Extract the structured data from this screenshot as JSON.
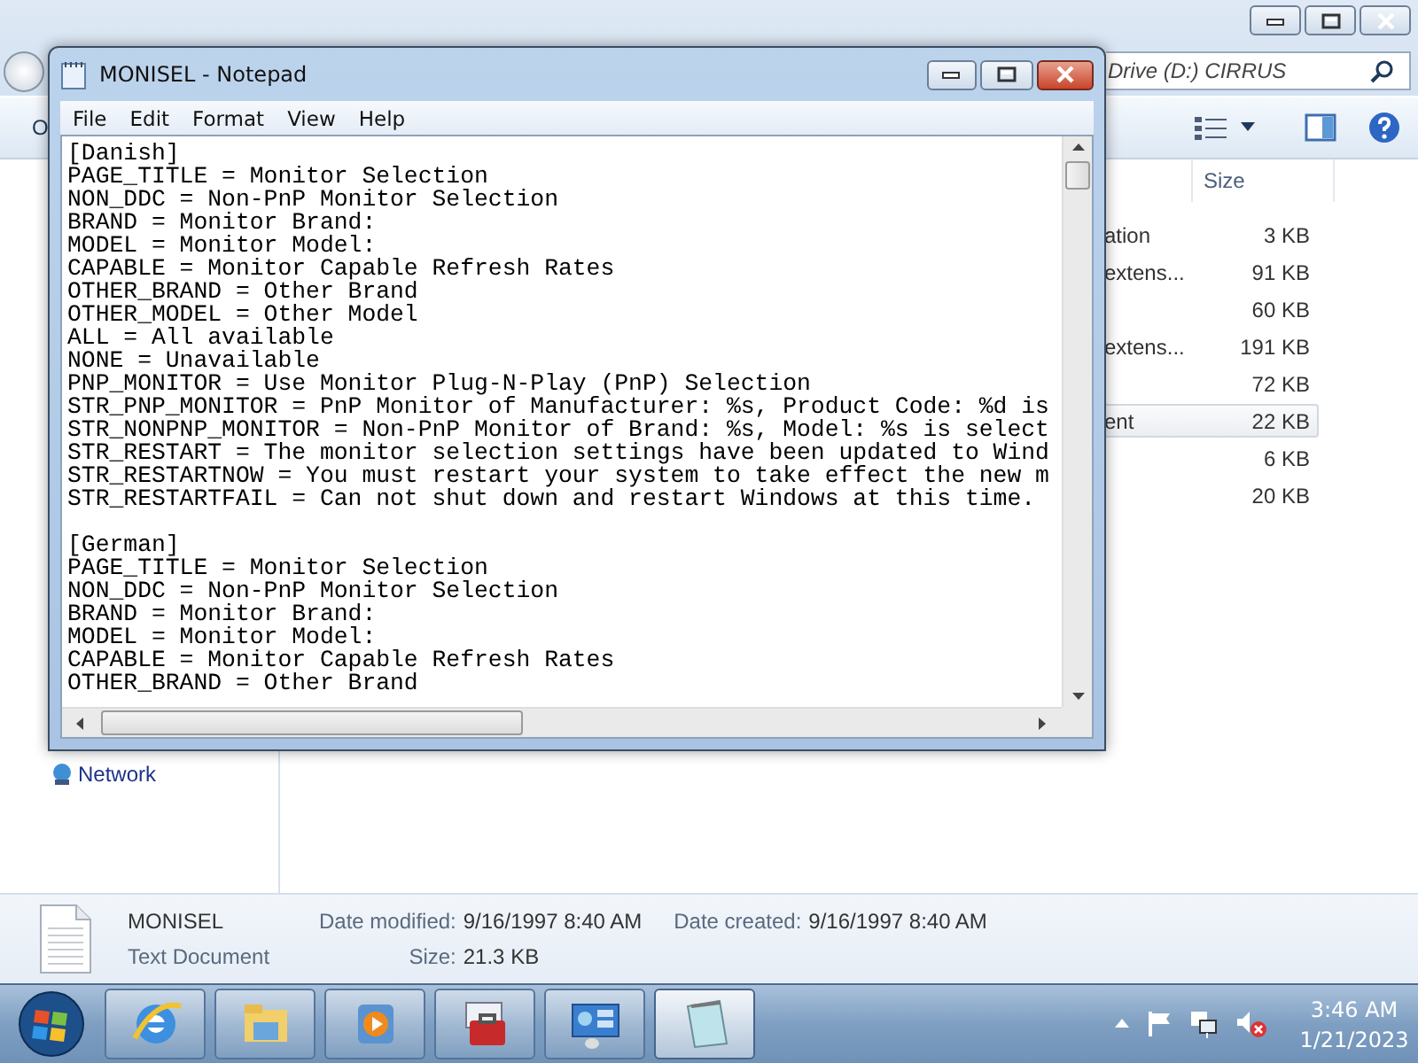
{
  "explorer": {
    "address": "Drive (D:) CIRRUS",
    "toolbar_label": "O",
    "size_header": "Size",
    "rows": [
      {
        "type": "ation",
        "size": "3 KB",
        "selected": false
      },
      {
        "type": "extens...",
        "size": "91 KB",
        "selected": false
      },
      {
        "size": "60 KB",
        "selected": false
      },
      {
        "type": "extens...",
        "size": "191 KB",
        "selected": false
      },
      {
        "size": "72 KB",
        "selected": false
      },
      {
        "type": "ent",
        "size": "22 KB",
        "selected": true
      },
      {
        "size": "6 KB",
        "selected": false
      },
      {
        "size": "20 KB",
        "selected": false
      }
    ],
    "nav": [
      {
        "label": "Network"
      }
    ]
  },
  "notepad": {
    "title": "MONISEL - Notepad",
    "menu": [
      "File",
      "Edit",
      "Format",
      "View",
      "Help"
    ],
    "sections": [
      {
        "lines": [
          "[Danish]",
          "PAGE_TITLE = Monitor Selection",
          "NON_DDC = Non-PnP Monitor Selection",
          "BRAND = Monitor Brand:",
          "MODEL = Monitor Model:",
          "CAPABLE = Monitor Capable Refresh Rates",
          "OTHER_BRAND = Other Brand",
          "OTHER_MODEL = Other Model",
          "ALL = All available",
          "NONE = Unavailable",
          "PNP_MONITOR = Use Monitor Plug-N-Play (PnP) Selection",
          "STR_PNP_MONITOR = PnP Monitor of Manufacturer: %s, Product Code: %d is",
          "STR_NONPNP_MONITOR = Non-PnP Monitor of Brand: %s, Model: %s is select",
          "STR_RESTART = The monitor selection settings have been updated to Wind",
          "STR_RESTARTNOW = You must restart your system to take effect the new m",
          "STR_RESTARTFAIL = Can not shut down and restart Windows at this time."
        ]
      },
      {
        "lines": [
          "[German]",
          "PAGE_TITLE = Monitor Selection",
          "NON_DDC = Non-PnP Monitor Selection",
          "BRAND = Monitor Brand:",
          "MODEL = Monitor Model:",
          "CAPABLE = Monitor Capable Refresh Rates",
          "OTHER_BRAND = Other Brand"
        ]
      }
    ]
  },
  "details": {
    "name": "MONISEL",
    "type": "Text Document",
    "fields": [
      {
        "label": "Date modified:",
        "value": "9/16/1997 8:40 AM"
      },
      {
        "label": "Size:",
        "value": "21.3 KB"
      },
      {
        "label": "Date created:",
        "value": "9/16/1997 8:40 AM"
      }
    ]
  },
  "taskbar": {
    "buttons": [
      {
        "kind": "browser",
        "selected": false
      },
      {
        "kind": "folder",
        "selected": false
      },
      {
        "kind": "media",
        "selected": false
      },
      {
        "kind": "toolbox",
        "selected": false
      },
      {
        "kind": "panel",
        "selected": false
      },
      {
        "kind": "notepad",
        "selected": true
      }
    ],
    "time": "3:46 AM",
    "date": "1/21/2023"
  }
}
